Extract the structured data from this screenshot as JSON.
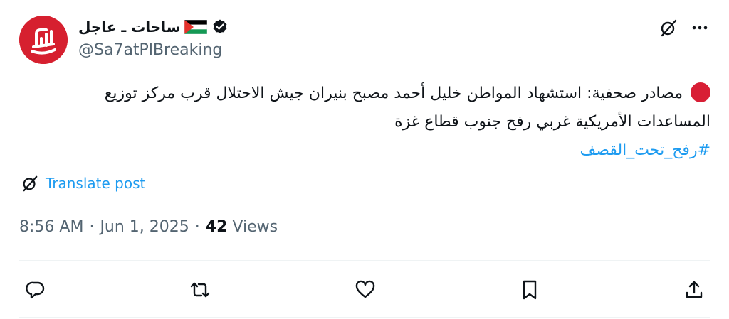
{
  "account": {
    "display_name": "ساحات ـ عاجل",
    "handle": "@Sa7atPlBreaking",
    "avatar_icon": "sa7at-logo",
    "verified_icon": "verified-badge-icon",
    "flag_icon": "palestine-flag-icon"
  },
  "post": {
    "text": "مصادر صحفية: استشهاد المواطن خليل أحمد مصبح بنيران جيش الاحتلال قرب مركز توزيع المساعدات الأمريكية غربي رفح جنوب قطاع غزة",
    "hashtag": "#رفح_تحت_القصف",
    "translate_label": "Translate post"
  },
  "meta": {
    "time": "8:56 AM",
    "separator1": "·",
    "date": "Jun 1, 2025",
    "separator2": "·",
    "views_count": "42",
    "views_label": "Views"
  },
  "colors": {
    "accent": "#1d9bf0",
    "brand_red": "#d6202f",
    "muted_text": "#536471"
  },
  "actions": [
    "reply-icon",
    "repost-icon",
    "like-icon",
    "bookmark-icon",
    "share-icon"
  ]
}
